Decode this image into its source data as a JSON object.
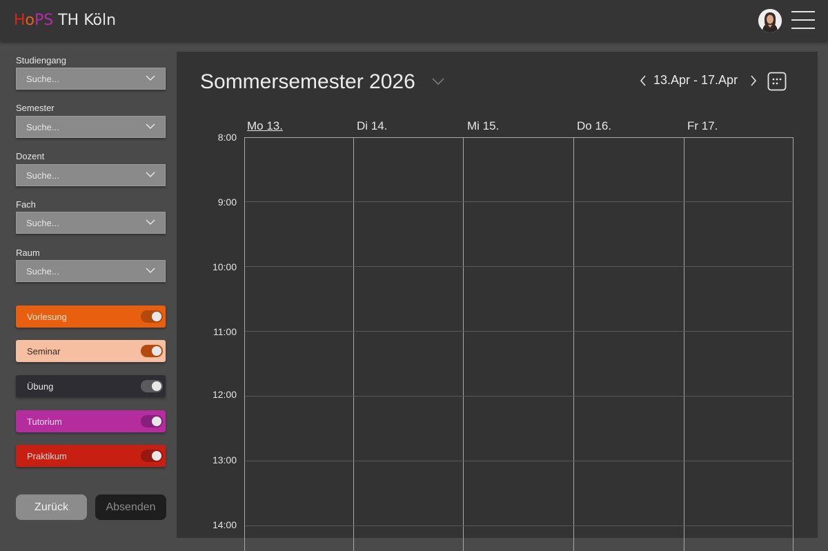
{
  "app": {
    "brand_h": "H",
    "brand_o": "o",
    "brand_ps": "PS",
    "brand_rest": " TH Köln"
  },
  "sidebar": {
    "fields": [
      {
        "label": "Studiengang",
        "placeholder": "Suche..."
      },
      {
        "label": "Semester",
        "placeholder": "Suche..."
      },
      {
        "label": "Dozent",
        "placeholder": "Suche..."
      },
      {
        "label": "Fach",
        "placeholder": "Suche..."
      },
      {
        "label": "Raum",
        "placeholder": "Suche..."
      }
    ],
    "filters": [
      {
        "label": "Vorlesung",
        "bg": "#e8600f",
        "text": "#fbe4d4",
        "toggle": "#b14a0c",
        "on": true
      },
      {
        "label": "Seminar",
        "bg": "#f6bfa2",
        "text": "#3a2a22",
        "toggle": "#b44a10",
        "on": true
      },
      {
        "label": "Übung",
        "bg": "#2e2d34",
        "text": "#e6e6e6",
        "toggle": "#5a5a5f",
        "on": true
      },
      {
        "label": "Tutorium",
        "bg": "#b52c9f",
        "text": "#f6dcef",
        "toggle": "#86207a",
        "on": true
      },
      {
        "label": "Praktikum",
        "bg": "#c71f12",
        "text": "#fbdad6",
        "toggle": "#961810",
        "on": true
      }
    ],
    "back_label": "Zurück",
    "submit_label": "Absenden"
  },
  "calendar": {
    "title": "Sommersemester 2026",
    "range": "13.Apr - 17.Apr",
    "days": [
      "Mo 13.",
      "Di 14.",
      "Mi 15.",
      "Do 16.",
      "Fr 17."
    ],
    "active_day": "Mo 13.",
    "hours": [
      "8:00",
      "9:00",
      "10:00",
      "11:00",
      "12:00",
      "13:00",
      "14:00"
    ]
  }
}
